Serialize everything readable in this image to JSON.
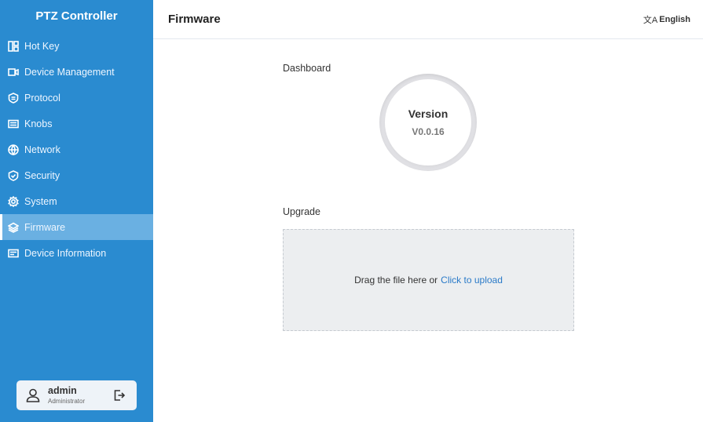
{
  "sidebar": {
    "brand": "PTZ Controller",
    "items": [
      {
        "label": "Hot Key",
        "icon": "hotkey-icon",
        "active": false
      },
      {
        "label": "Device Management",
        "icon": "camera-icon",
        "active": false
      },
      {
        "label": "Protocol",
        "icon": "protocol-icon",
        "active": false
      },
      {
        "label": "Knobs",
        "icon": "keyboard-icon",
        "active": false
      },
      {
        "label": "Network",
        "icon": "globe-icon",
        "active": false
      },
      {
        "label": "Security",
        "icon": "shield-icon",
        "active": false
      },
      {
        "label": "System",
        "icon": "gear-icon",
        "active": false
      },
      {
        "label": "Firmware",
        "icon": "layers-icon",
        "active": true
      },
      {
        "label": "Device Information",
        "icon": "info-card-icon",
        "active": false
      }
    ],
    "user": {
      "name": "admin",
      "role": "Administrator"
    }
  },
  "header": {
    "title": "Firmware",
    "language": "English",
    "language_icon": "translate-icon"
  },
  "dashboard": {
    "title": "Dashboard",
    "version_label": "Version",
    "version_value": "V0.0.16"
  },
  "upgrade": {
    "title": "Upgrade",
    "drop_text": "Drag the file here or",
    "upload_link": "Click to upload"
  },
  "colors": {
    "sidebar": "#2a8bd0",
    "active_item": "#6ab0e2",
    "link": "#2a7ac8"
  }
}
